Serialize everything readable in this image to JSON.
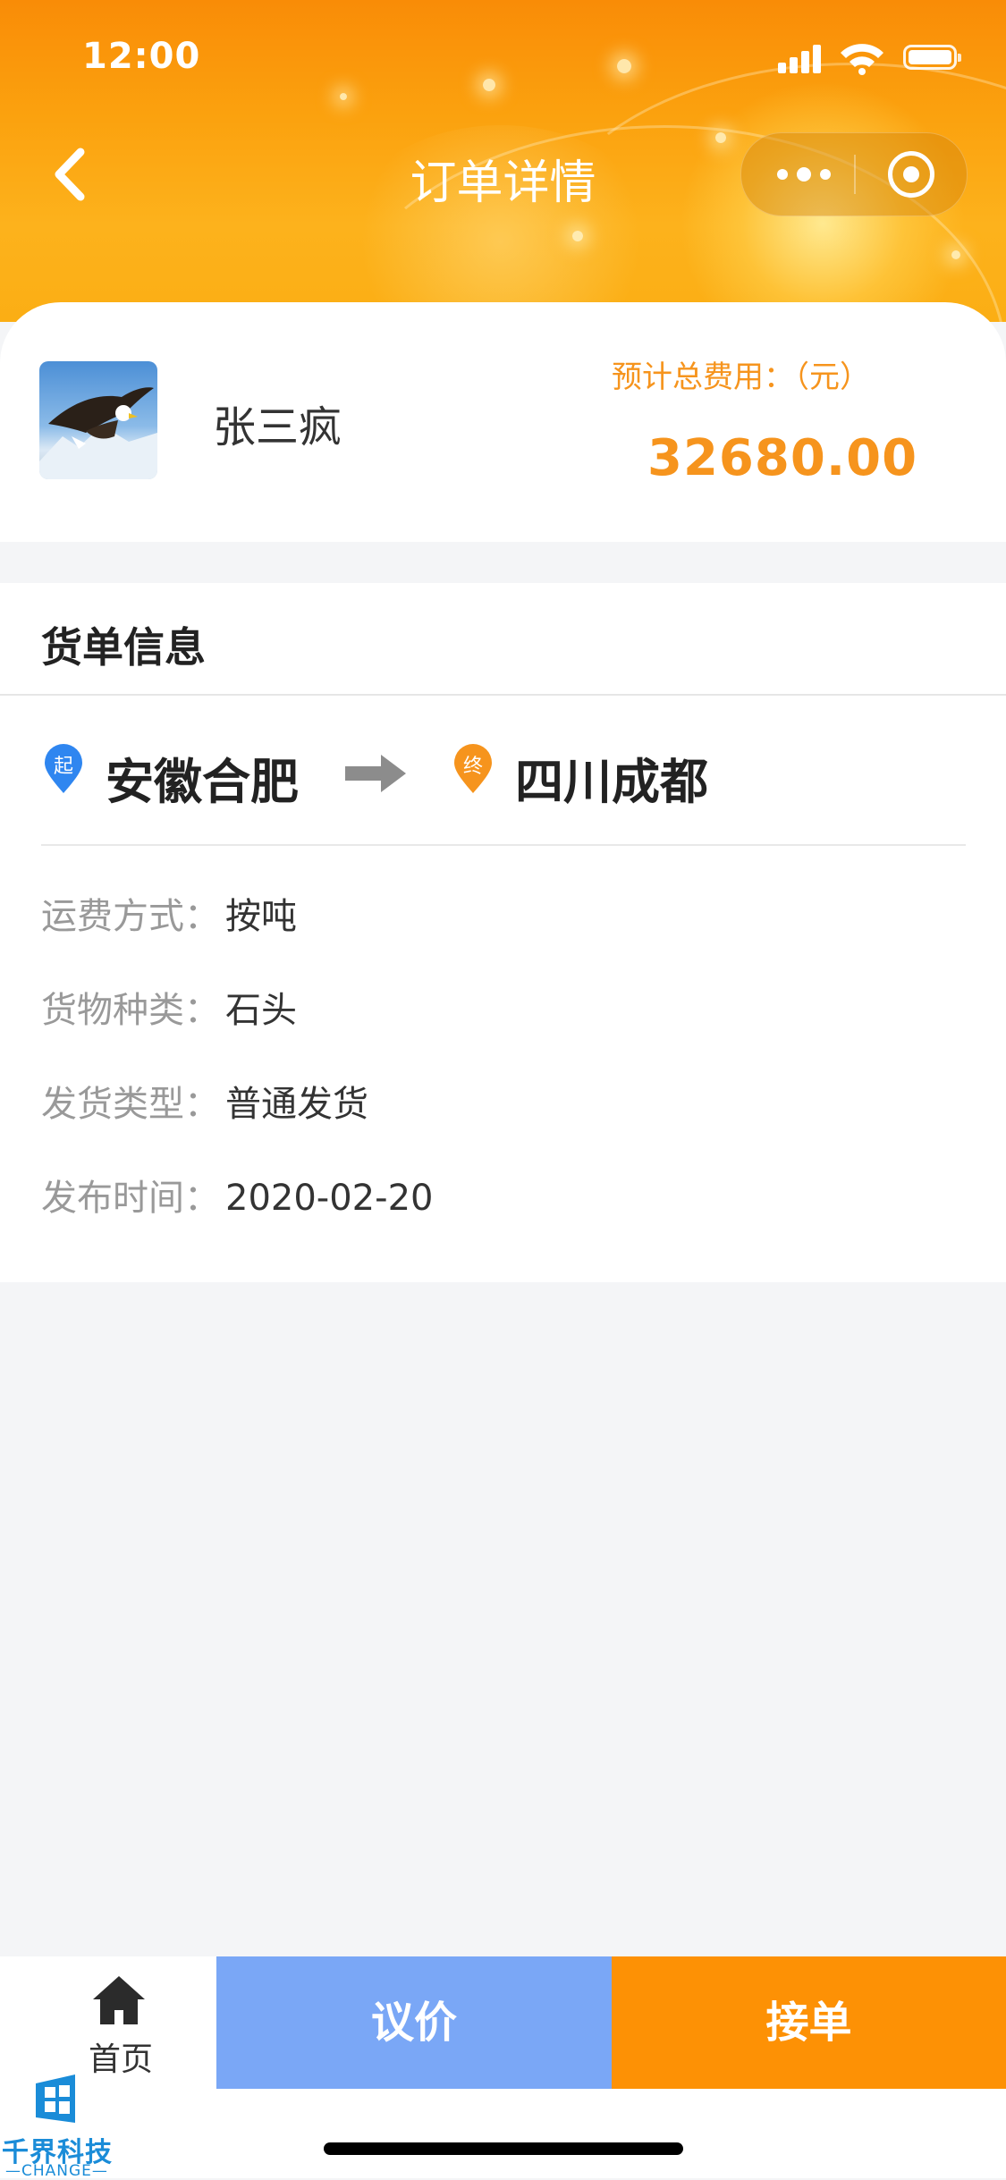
{
  "status_bar": {
    "time": "12:00"
  },
  "nav": {
    "title": "订单详情"
  },
  "profile": {
    "name": "张三疯",
    "fee_label": "预计总费用：（元）",
    "fee_value": "32680.00"
  },
  "section": {
    "title": "货单信息"
  },
  "route": {
    "start_badge": "起",
    "start_city": "安徽合肥",
    "end_badge": "终",
    "end_city": "四川成都"
  },
  "details": [
    {
      "label": "运费方式：",
      "value": "按吨"
    },
    {
      "label": "货物种类：",
      "value": "石头"
    },
    {
      "label": "发货类型：",
      "value": "普通发货"
    },
    {
      "label": "发布时间：",
      "value": "2020-02-20"
    }
  ],
  "bottom_bar": {
    "home_label": "首页",
    "bargain_label": "议价",
    "accept_label": "接单"
  },
  "watermark": {
    "cn": "千界科技",
    "en": "—CHANGE—"
  },
  "colors": {
    "accent_orange": "#fd9105",
    "fee_orange": "#f6941d",
    "bargain_blue": "#7aa7f6",
    "start_pin": "#2f86f0",
    "end_pin": "#f6941d"
  },
  "icons": [
    "back-chevron-icon",
    "more-dots-icon",
    "close-target-icon",
    "location-pin-icon",
    "arrow-right-icon",
    "home-icon"
  ]
}
